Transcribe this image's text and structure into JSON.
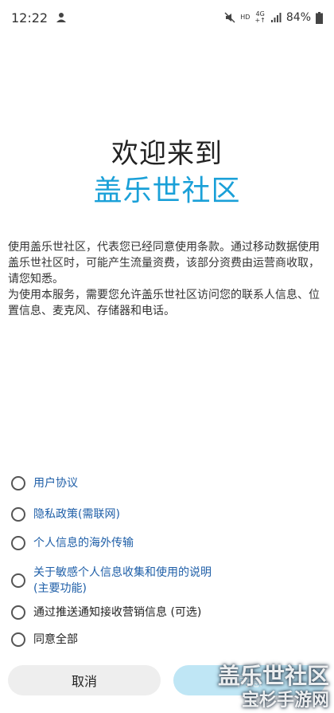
{
  "status_bar": {
    "time": "12:22",
    "network_small_top": "HD",
    "network_small_4g": "4G",
    "network_small_arrows": "+↑",
    "battery": "84%",
    "icons": [
      "person-icon",
      "mute-icon",
      "signal-icon",
      "battery-icon"
    ]
  },
  "header": {
    "welcome": "欢迎来到",
    "app_name": "盖乐世社区"
  },
  "body": {
    "paragraph_1": "使用盖乐世社区，代表您已经同意使用条款。通过移动数据使用盖乐世社区时，可能产生流量资费，该部分资费由运营商收取，请您知悉。",
    "paragraph_2": "为使用本服务，需要您允许盖乐世社区访问您的联系人信息、位置信息、麦克风、存储器和电话。"
  },
  "consents": [
    {
      "label": "用户协议"
    },
    {
      "label": "隐私政策(需联网)"
    },
    {
      "label": "个人信息的海外传输"
    },
    {
      "label": "关于敏感个人信息收集和使用的说明\n(主要功能)"
    },
    {
      "label": "通过推送通知接收营销信息 (可选)"
    },
    {
      "label": "同意全部"
    }
  ],
  "buttons": {
    "cancel": "取消",
    "agree": "同意"
  },
  "watermark": {
    "line1": "盖乐世社区",
    "line2": "宝杉手游网"
  },
  "colors": {
    "accent": "#1aa0d8",
    "link": "#1f5fa8",
    "agree_button": "#bfe6f5",
    "cancel_button": "#eeeeee"
  }
}
